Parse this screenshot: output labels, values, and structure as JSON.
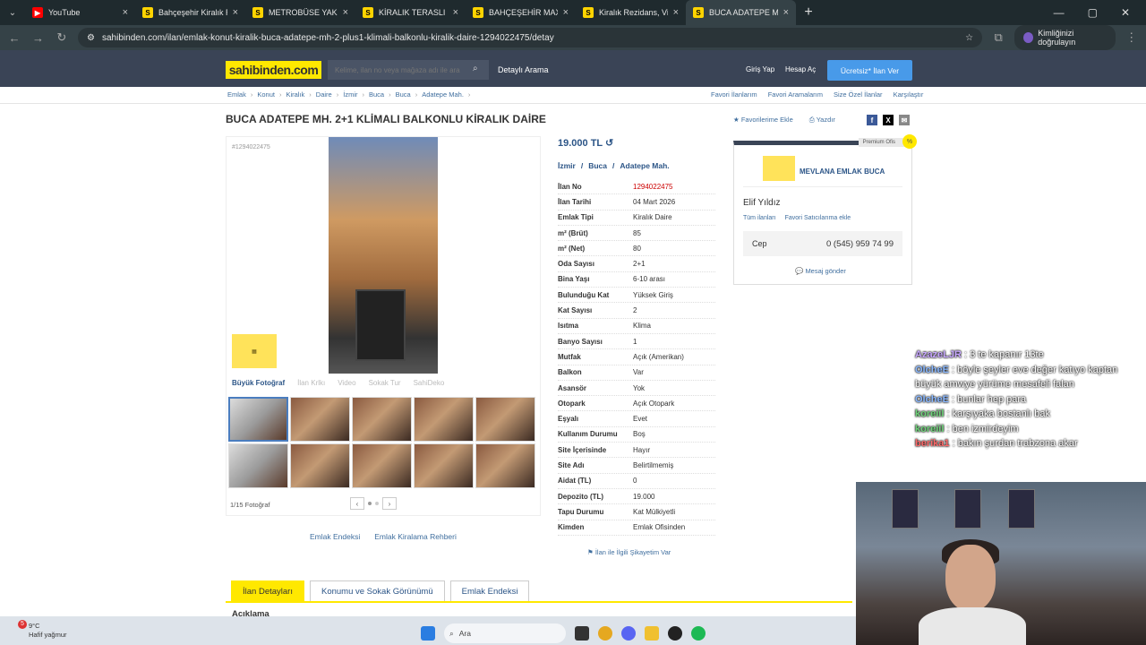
{
  "browser": {
    "tabs": [
      {
        "label": "YouTube",
        "icon": "youtube-icon"
      },
      {
        "label": "Bahçeşehir Kiralık Re",
        "icon": "sahibinden-icon"
      },
      {
        "label": "METROBÜSE YAKIN F",
        "icon": "sahibinden-icon"
      },
      {
        "label": "KİRALIK TERASLI DAİ",
        "icon": "sahibinden-icon"
      },
      {
        "label": "BAHÇEŞEHİR MAXİM",
        "icon": "sahibinden-icon"
      },
      {
        "label": "Kiralık Rezidans, Villa",
        "icon": "sahibinden-icon"
      },
      {
        "label": "BUCA ADATEPE MH.",
        "icon": "sahibinden-icon"
      }
    ],
    "url": "sahibinden.com/ilan/emlak-konut-kiralik-buca-adatepe-mh-2-plus1-klimali-balkonlu-kiralik-daire-1294022475/detay",
    "profile_label": "Kimliğinizi doğrulayın"
  },
  "header": {
    "logo": "sahibinden.com",
    "search_placeholder": "Kelime, ilan no veya mağaza adı ile ara",
    "detailed_search": "Detaylı Arama",
    "login": "Giriş Yap",
    "signup": "Hesap Aç",
    "post_ad": "Ücretsiz* İlan Ver"
  },
  "breadcrumb": [
    "Emlak",
    "Konut",
    "Kiralık",
    "Daire",
    "İzmir",
    "Buca",
    "Buca",
    "Adatepe Mah."
  ],
  "breadcrumb_right": [
    "Favori İlanlarım",
    "Favori Aramalarım",
    "Size Özel İlanlar",
    "Karşılaştır"
  ],
  "listing": {
    "title": "BUCA ADATEPE MH. 2+1 KLİMALI BALKONLU KİRALIK DAİRE",
    "add_favorite": "Favorilerime Ekle",
    "print": "Yazdır",
    "id_label": "#1294022475",
    "price": "19.000 TL",
    "location": [
      "İzmir",
      "/",
      "Buca",
      "/",
      "Adatepe Mah."
    ],
    "details": [
      {
        "k": "İlan No",
        "v": "1294022475"
      },
      {
        "k": "İlan Tarihi",
        "v": "04 Mart 2026"
      },
      {
        "k": "Emlak Tipi",
        "v": "Kiralık Daire"
      },
      {
        "k": "m² (Brüt)",
        "v": "85"
      },
      {
        "k": "m² (Net)",
        "v": "80"
      },
      {
        "k": "Oda Sayısı",
        "v": "2+1"
      },
      {
        "k": "Bina Yaşı",
        "v": "6-10 arası"
      },
      {
        "k": "Bulunduğu Kat",
        "v": "Yüksek Giriş"
      },
      {
        "k": "Kat Sayısı",
        "v": "2"
      },
      {
        "k": "Isıtma",
        "v": "Klima"
      },
      {
        "k": "Banyo Sayısı",
        "v": "1"
      },
      {
        "k": "Mutfak",
        "v": "Açık (Amerikan)"
      },
      {
        "k": "Balkon",
        "v": "Var"
      },
      {
        "k": "Asansör",
        "v": "Yok"
      },
      {
        "k": "Otopark",
        "v": "Açık Otopark"
      },
      {
        "k": "Eşyalı",
        "v": "Evet"
      },
      {
        "k": "Kullanım Durumu",
        "v": "Boş"
      },
      {
        "k": "Site İçerisinde",
        "v": "Hayır"
      },
      {
        "k": "Site Adı",
        "v": "Belirtilmemiş"
      },
      {
        "k": "Aidat (TL)",
        "v": "0"
      },
      {
        "k": "Depozito (TL)",
        "v": "19.000"
      },
      {
        "k": "Tapu Durumu",
        "v": "Kat Mülkiyetli"
      },
      {
        "k": "Kimden",
        "v": "Emlak Ofisinden"
      }
    ],
    "complain": "İlan ile İlgili Şikayetim Var"
  },
  "gallery": {
    "tabs": [
      "Büyük Fotoğraf",
      "İlan Krlkı",
      "Video",
      "Sokak Tur",
      "SahiDeko"
    ],
    "count": "1/15 Fotoğraf",
    "links": [
      "Emlak Endeksi",
      "Emlak Kiralama Rehberi"
    ]
  },
  "agent": {
    "premium": "Premium Ofis",
    "office": "MEVLANA EMLAK BUCA",
    "person": "Elif Yıldız",
    "links": [
      "Tüm ilanları",
      "Favori Satıcılarıma ekle"
    ],
    "phone_label": "Cep",
    "phone": "0 (545) 959 74 99",
    "message": "Mesaj gönder"
  },
  "bottom_tabs": [
    "İlan Detayları",
    "Konumu ve Sokak Görünümü",
    "Emlak Endeksi"
  ],
  "description_heading": "Açıklama",
  "chat": [
    {
      "nick": "AzazeLJR",
      "color": "#c8a8ff",
      "text": ": 3 te kapanır 13te"
    },
    {
      "nick": "OlcheE",
      "color": "#8ab8ff",
      "text": ": böyle şeyler eve değer katıyo kaptan büyük amwye yürüme mesafeli falan"
    },
    {
      "nick": "OlcheE",
      "color": "#8ab8ff",
      "text": ": bunlar hep para"
    },
    {
      "nick": "koreiil",
      "color": "#6fd37a",
      "text": ": karşıyaka bostanlı bak"
    },
    {
      "nick": "koreiil",
      "color": "#6fd37a",
      "text": ": ben izmirdeyim"
    },
    {
      "nick": "berika1",
      "color": "#ff6b6b",
      "text": ": bakın şurdan trabzona akar"
    }
  ],
  "taskbar": {
    "weather_badge": "5",
    "temp": "9°C",
    "weather": "Hafif yağmur",
    "search": "Ara"
  }
}
